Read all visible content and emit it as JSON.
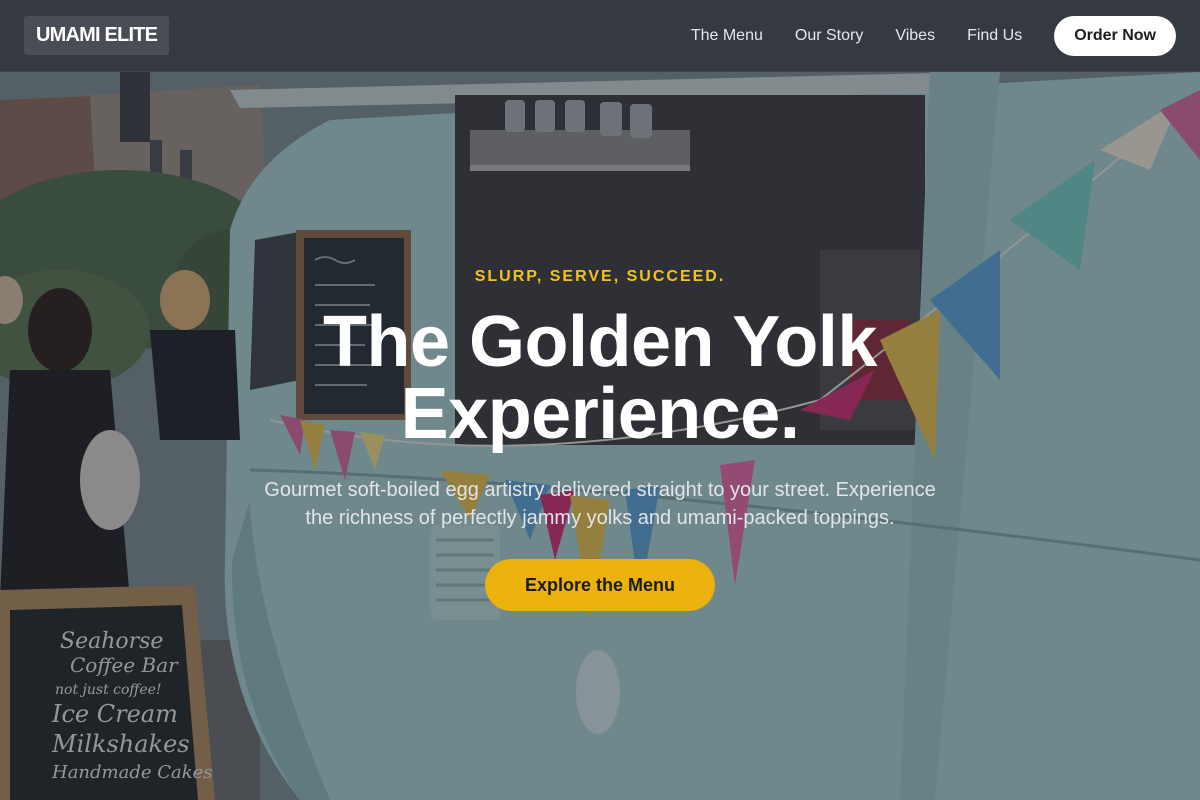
{
  "brand": {
    "logo_text": "UMAMI ELITE"
  },
  "nav": {
    "links": [
      {
        "label": "The Menu"
      },
      {
        "label": "Our Story"
      },
      {
        "label": "Vibes"
      },
      {
        "label": "Find Us"
      }
    ],
    "cta_label": "Order Now"
  },
  "hero": {
    "tagline": "SLURP, SERVE, SUCCEED.",
    "headline_line1": "The Golden Yolk",
    "headline_line2": "Experience.",
    "subtext": "Gourmet soft-boiled egg artistry delivered straight to your street. Experience the richness of perfectly jammy yolks and umami-packed toppings.",
    "cta_label": "Explore the Menu"
  },
  "background_photo": {
    "sign_lines": [
      "Seahorse",
      "Coffee Bar",
      "not just coffee!",
      "Ice Cream",
      "Milkshakes",
      "Handmade Cakes"
    ]
  },
  "colors": {
    "accent": "#ebb10c",
    "tagline": "#f2c419",
    "navbar": "#343840",
    "van": "#a9d3d2"
  }
}
